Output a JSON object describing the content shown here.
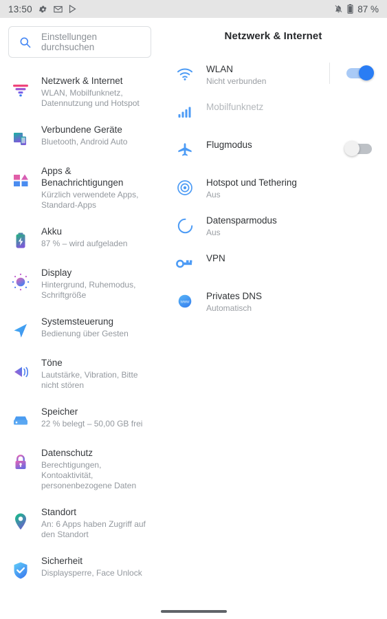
{
  "statusbar": {
    "time": "13:50",
    "left_icons": [
      {
        "name": "settings-gear-icon"
      },
      {
        "name": "gmail-icon"
      },
      {
        "name": "play-store-icon"
      }
    ],
    "right": {
      "dnd_icon": "notifications-off-icon",
      "battery_icon": "battery-icon",
      "battery_label": "87 %"
    }
  },
  "search": {
    "icon": "search-icon",
    "placeholder": "Einstellungen durchsuchen"
  },
  "sidebar": {
    "items": [
      {
        "icon": "network-signal-icon",
        "title": "Netzwerk & Internet",
        "subtitle": "WLAN, Mobilfunknetz, Datennutzung und Hotspot"
      },
      {
        "icon": "connected-devices-icon",
        "title": "Verbundene Geräte",
        "subtitle": "Bluetooth, Android Auto"
      },
      {
        "icon": "apps-icon",
        "title": "Apps & Benachrichtigungen",
        "subtitle": "Kürzlich verwendete Apps, Standard-Apps"
      },
      {
        "icon": "battery-icon",
        "title": "Akku",
        "subtitle": "87 % – wird aufgeladen"
      },
      {
        "icon": "display-brightness-icon",
        "title": "Display",
        "subtitle": "Hintergrund, Ruhemodus, Schriftgröße"
      },
      {
        "icon": "cursor-arrow-icon",
        "title": "Systemsteuerung",
        "subtitle": "Bedienung über Gesten"
      },
      {
        "icon": "sound-speaker-icon",
        "title": "Töne",
        "subtitle": "Lautstärke, Vibration, Bitte nicht stören"
      },
      {
        "icon": "storage-drive-icon",
        "title": "Speicher",
        "subtitle": "22 % belegt – 50,00 GB frei"
      },
      {
        "icon": "privacy-lock-icon",
        "title": "Datenschutz",
        "subtitle": "Berechtigungen, Kontoaktivität, personenbezogene Daten"
      },
      {
        "icon": "location-pin-icon",
        "title": "Standort",
        "subtitle": "An: 6 Apps haben Zugriff auf den Standort"
      },
      {
        "icon": "security-shield-icon",
        "title": "Sicherheit",
        "subtitle": "Displaysperre, Face Unlock"
      }
    ]
  },
  "detail": {
    "title": "Netzwerk & Internet",
    "rows": [
      {
        "icon": "wifi-icon",
        "title": "WLAN",
        "subtitle": "Nicht verbunden",
        "toggle": "on",
        "divider": true,
        "disabled": false
      },
      {
        "icon": "cellular-signal-icon",
        "title": "Mobilfunknetz",
        "subtitle": "",
        "toggle": "none",
        "divider": false,
        "disabled": true
      },
      {
        "icon": "airplane-icon",
        "title": "Flugmodus",
        "subtitle": "",
        "toggle": "off",
        "divider": false,
        "disabled": false
      },
      {
        "icon": "hotspot-icon",
        "title": "Hotspot und Tethering",
        "subtitle": "Aus",
        "toggle": "none",
        "divider": false,
        "disabled": false
      },
      {
        "icon": "data-saver-icon",
        "title": "Datensparmodus",
        "subtitle": "Aus",
        "toggle": "none",
        "divider": false,
        "disabled": false
      },
      {
        "icon": "vpn-key-icon",
        "title": "VPN",
        "subtitle": "",
        "toggle": "none",
        "divider": false,
        "disabled": false
      },
      {
        "icon": "private-dns-icon",
        "title": "Privates DNS",
        "subtitle": "Automatisch",
        "toggle": "none",
        "divider": false,
        "disabled": false
      }
    ]
  },
  "navbar": {
    "home_indicator": "home-gesture-bar"
  },
  "colors": {
    "accent_blue": "#2a7df4",
    "icon_blue": "#4c9bf5",
    "status_bar_bg": "#e5e5e5",
    "title_text": "#303336",
    "sub_text": "#9a9ea3"
  }
}
